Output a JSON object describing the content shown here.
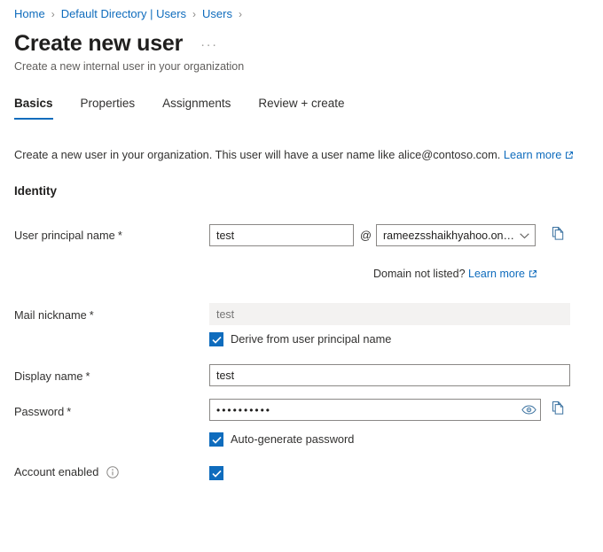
{
  "breadcrumb": {
    "items": [
      {
        "label": "Home",
        "icon": "chevron-right-icon"
      },
      {
        "label": "Default Directory | Users",
        "icon": "chevron-right-icon"
      },
      {
        "label": "Users",
        "icon": "chevron-right-icon"
      }
    ],
    "separator": "›"
  },
  "header": {
    "title": "Create new user",
    "more_label": "···",
    "subtitle": "Create a new internal user in your organization"
  },
  "tabs": [
    {
      "label": "Basics",
      "active": true
    },
    {
      "label": "Properties",
      "active": false
    },
    {
      "label": "Assignments",
      "active": false
    },
    {
      "label": "Review + create",
      "active": false
    }
  ],
  "description": {
    "text": "Create a new user in your organization. This user will have a user name like alice@contoso.com.",
    "link_label": "Learn more",
    "link_icon": "external-link-icon"
  },
  "section": {
    "heading": "Identity"
  },
  "fields": {
    "upn": {
      "label": "User principal name",
      "required": "*",
      "value": "test",
      "placeholder": "",
      "at_sign": "@",
      "domain_value": "rameezsshaikhyahoo.on…",
      "domain_icon": "chevron-down-icon",
      "copy_icon": "copy-icon",
      "helper_text": "Domain not listed?",
      "helper_link": "Learn more",
      "helper_link_icon": "external-link-icon"
    },
    "mail_nickname": {
      "label": "Mail nickname",
      "required": "*",
      "value": "",
      "placeholder": "test",
      "disabled": true,
      "checkbox_label": "Derive from user principal name",
      "checkbox_checked": true
    },
    "display_name": {
      "label": "Display name",
      "required": "*",
      "value": "test",
      "placeholder": ""
    },
    "password": {
      "label": "Password",
      "required": "*",
      "value": "••••••••••",
      "reveal_icon": "eye-icon",
      "copy_icon": "copy-icon",
      "checkbox_label": "Auto-generate password",
      "checkbox_checked": true
    },
    "account_enabled": {
      "label": "Account enabled",
      "info_icon": "info-icon",
      "checked": true
    }
  },
  "colors": {
    "accent": "#0f6cbd",
    "link": "#0f6cbd",
    "text": "#323130",
    "muted": "#605e5c",
    "border": "#8a8886",
    "disabled_bg": "#f3f2f1"
  }
}
